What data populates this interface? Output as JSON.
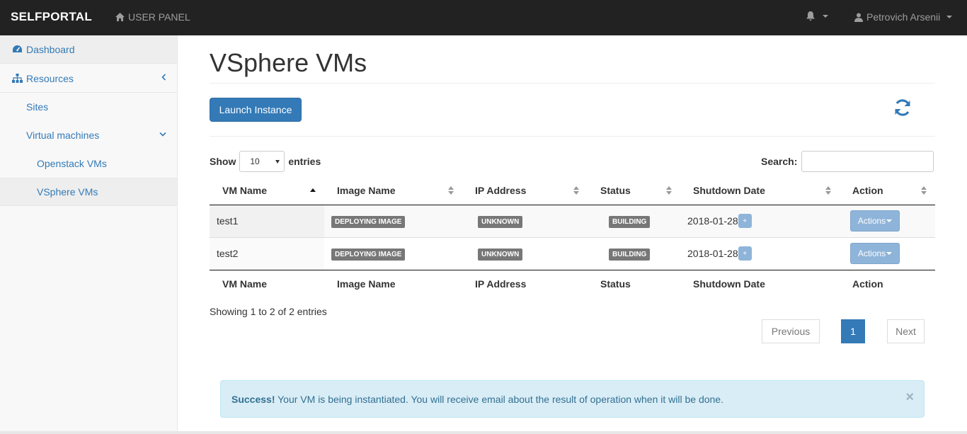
{
  "navbar": {
    "brand": "SELFPORTAL",
    "user_panel": "USER PANEL",
    "user_name": "Petrovich Arsenii"
  },
  "sidebar": {
    "items": [
      {
        "label": "Dashboard"
      },
      {
        "label": "Resources"
      },
      {
        "label": "Sites"
      },
      {
        "label": "Virtual machines"
      },
      {
        "label": "Openstack VMs"
      },
      {
        "label": "VSphere VMs"
      }
    ]
  },
  "main": {
    "title": "VSphere VMs",
    "launch_label": "Launch Instance",
    "show_label": "Show",
    "entries_value": "10",
    "entries_label": "entries",
    "search_label": "Search:",
    "columns": [
      "VM Name",
      "Image Name",
      "IP Address",
      "Status",
      "Shutdown Date",
      "Action"
    ],
    "rows": [
      {
        "vm": "test1",
        "image": "DEPLOYING IMAGE",
        "ip": "UNKNOWN",
        "status": "BUILDING",
        "date": "2018-01-28",
        "plus": "+",
        "action": "Actions"
      },
      {
        "vm": "test2",
        "image": "DEPLOYING IMAGE",
        "ip": "UNKNOWN",
        "status": "BUILDING",
        "date": "2018-01-28",
        "plus": "+",
        "action": "Actions"
      }
    ],
    "info": "Showing 1 to 2 of 2 entries",
    "pagination": {
      "previous": "Previous",
      "current": "1",
      "next": "Next"
    },
    "alert": {
      "strong": "Success!",
      "text": " Your VM is being instantiated. You will receive email about the result of operation when it will be done.",
      "close": "×"
    }
  },
  "colors": {
    "navbar": "#222222",
    "primary": "#337ab7",
    "label": "#777777",
    "alert_bg": "#d9edf7"
  }
}
